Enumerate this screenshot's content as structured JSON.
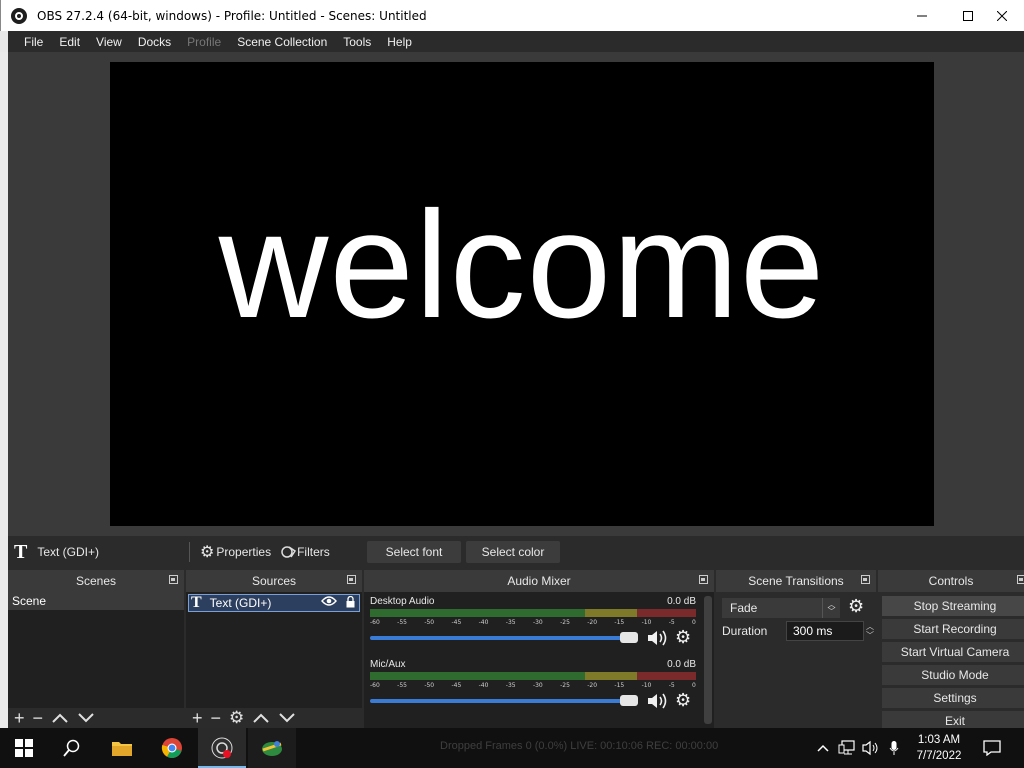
{
  "window": {
    "title": "OBS 27.2.4 (64-bit, windows) - Profile: Untitled - Scenes: Untitled"
  },
  "menu": {
    "items": [
      "File",
      "Edit",
      "View",
      "Docks",
      "Profile",
      "Scene Collection",
      "Tools",
      "Help"
    ],
    "disabled": [
      "Profile"
    ]
  },
  "preview": {
    "text": "welcome"
  },
  "source_toolbar": {
    "source_name": "Text (GDI+)",
    "properties_label": "Properties",
    "filters_label": "Filters",
    "select_font_label": "Select font",
    "select_color_label": "Select color"
  },
  "docks": {
    "scenes": {
      "title": "Scenes",
      "items": [
        "Scene"
      ]
    },
    "sources": {
      "title": "Sources",
      "items": [
        {
          "name": "Text (GDI+)",
          "type_icon": "text-icon",
          "visible": true,
          "locked": true
        }
      ]
    },
    "audio_mixer": {
      "title": "Audio Mixer",
      "ticks": [
        "-60",
        "-55",
        "-50",
        "-45",
        "-40",
        "-35",
        "-30",
        "-25",
        "-20",
        "-15",
        "-10",
        "-5",
        "0"
      ],
      "channels": [
        {
          "name": "Desktop Audio",
          "db": "0.0 dB",
          "volume": 1.0
        },
        {
          "name": "Mic/Aux",
          "db": "0.0 dB",
          "volume": 1.0
        }
      ]
    },
    "scene_transitions": {
      "title": "Scene Transitions",
      "transition": "Fade",
      "duration_label": "Duration",
      "duration_value": "300 ms"
    },
    "controls": {
      "title": "Controls",
      "buttons": [
        "Stop Streaming",
        "Start Recording",
        "Start Virtual Camera",
        "Studio Mode",
        "Settings",
        "Exit"
      ]
    }
  },
  "status_bar": {
    "text": "Dropped Frames 0 (0.0%)   LIVE: 00:10:06   REC: 00:00:00"
  },
  "taskbar": {
    "time": "1:03 AM",
    "date": "7/7/2022",
    "apps": [
      "windows-start-icon",
      "search-icon",
      "file-explorer-icon",
      "chrome-icon",
      "obs-icon",
      "app-icon"
    ]
  },
  "colors": {
    "accent": "#3a7bd5",
    "panel": "#2b2b2b",
    "dock_body": "#202020",
    "recording_dot": "#e81123"
  }
}
